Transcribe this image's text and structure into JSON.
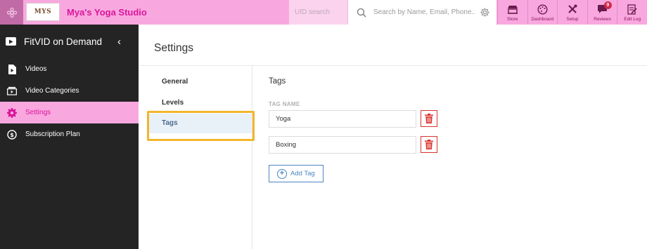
{
  "header": {
    "logo_text": "MYS",
    "studio_name": "Mya's Yoga Studio",
    "uid_search_placeholder": "UID search",
    "main_search_placeholder": "Search by Name, Email, Phone..",
    "nav": [
      {
        "label": "Store",
        "icon": "store-icon"
      },
      {
        "label": "Dashboard",
        "icon": "dashboard-icon"
      },
      {
        "label": "Setup",
        "icon": "setup-icon"
      },
      {
        "label": "Reviews",
        "icon": "reviews-icon",
        "badge": "9"
      },
      {
        "label": "Edit Log",
        "icon": "edit-log-icon"
      }
    ],
    "accent": "#d9159a",
    "bar_color": "#f9a8df"
  },
  "sidebar": {
    "title": "FitVID on Demand",
    "items": [
      {
        "label": "Videos",
        "icon": "video-file-icon"
      },
      {
        "label": "Video Categories",
        "icon": "video-categories-icon"
      },
      {
        "label": "Settings",
        "icon": "gear-icon",
        "active": true
      },
      {
        "label": "Subscription Plan",
        "icon": "subscription-icon"
      }
    ]
  },
  "main": {
    "page_title": "Settings",
    "subnav": [
      {
        "label": "General"
      },
      {
        "label": "Levels"
      },
      {
        "label": "Tags",
        "active": true
      }
    ],
    "section_title": "Tags",
    "column_label": "TAG NAME",
    "tags": [
      "Yoga",
      "Boxing"
    ],
    "add_button_label": "Add Tag"
  }
}
